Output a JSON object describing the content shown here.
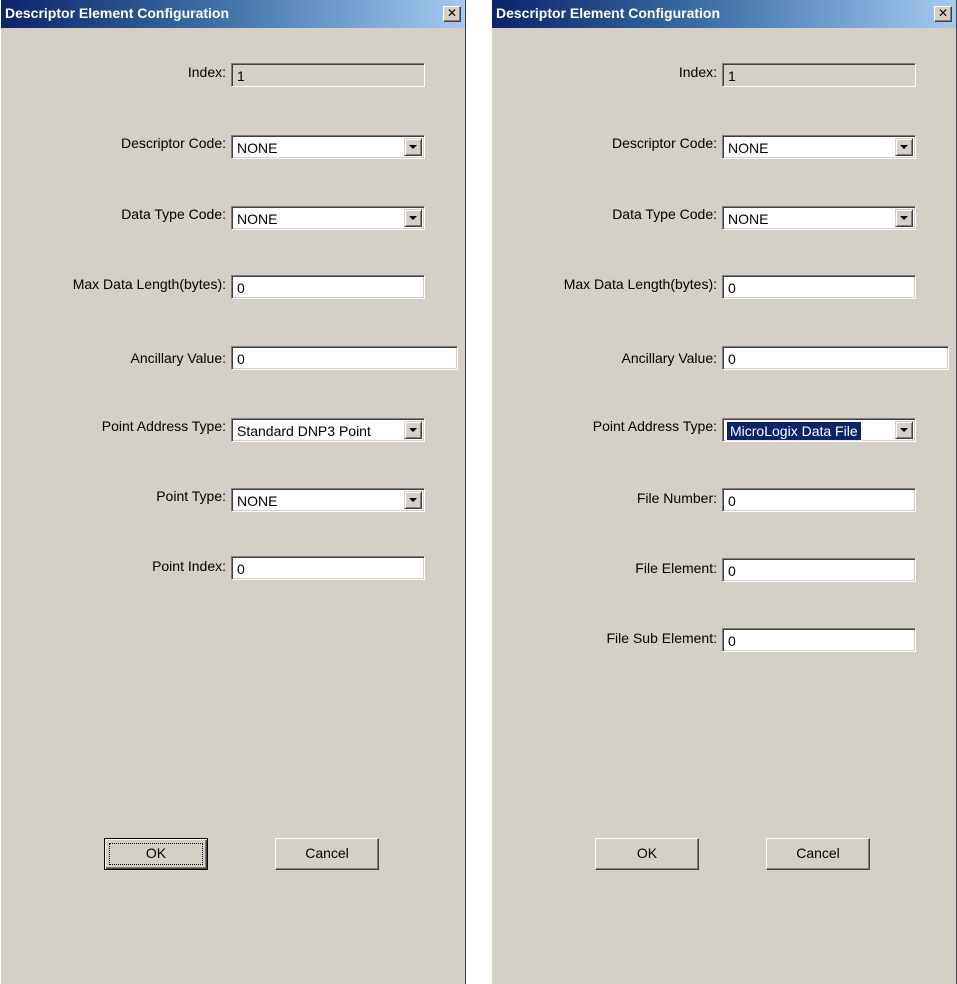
{
  "dialogs": [
    {
      "title": "Descriptor Element Configuration",
      "close_glyph": "✕",
      "fields": {
        "index": {
          "label": "Index:",
          "value": "1"
        },
        "descriptor_code": {
          "label": "Descriptor Code:",
          "value": "NONE"
        },
        "data_type_code": {
          "label": "Data Type Code:",
          "value": "NONE"
        },
        "max_data_length": {
          "label": "Max Data Length(bytes):",
          "value": "0"
        },
        "ancillary_value": {
          "label": "Ancillary Value:",
          "value": "0"
        },
        "point_address_type": {
          "label": "Point Address Type:",
          "value": "Standard DNP3 Point"
        },
        "point_type": {
          "label": "Point Type:",
          "value": "NONE"
        },
        "point_index": {
          "label": "Point Index:",
          "value": "0"
        }
      },
      "buttons": {
        "ok": "OK",
        "cancel": "Cancel"
      }
    },
    {
      "title": "Descriptor Element Configuration",
      "close_glyph": "✕",
      "fields": {
        "index": {
          "label": "Index:",
          "value": "1"
        },
        "descriptor_code": {
          "label": "Descriptor Code:",
          "value": "NONE"
        },
        "data_type_code": {
          "label": "Data Type Code:",
          "value": "NONE"
        },
        "max_data_length": {
          "label": "Max Data Length(bytes):",
          "value": "0"
        },
        "ancillary_value": {
          "label": "Ancillary Value:",
          "value": "0"
        },
        "point_address_type": {
          "label": "Point Address Type:",
          "value": "MicroLogix Data File"
        },
        "file_number": {
          "label": "File Number:",
          "value": "0"
        },
        "file_element": {
          "label": "File Element:",
          "value": "0"
        },
        "file_sub_element": {
          "label": "File Sub Element:",
          "value": "0"
        }
      },
      "buttons": {
        "ok": "OK",
        "cancel": "Cancel"
      }
    }
  ],
  "colors": {
    "dialog_face": "#d4d0c8",
    "title_gradient_start": "#0a246a",
    "title_gradient_end": "#a6caf0",
    "selection": "#0a246a"
  }
}
